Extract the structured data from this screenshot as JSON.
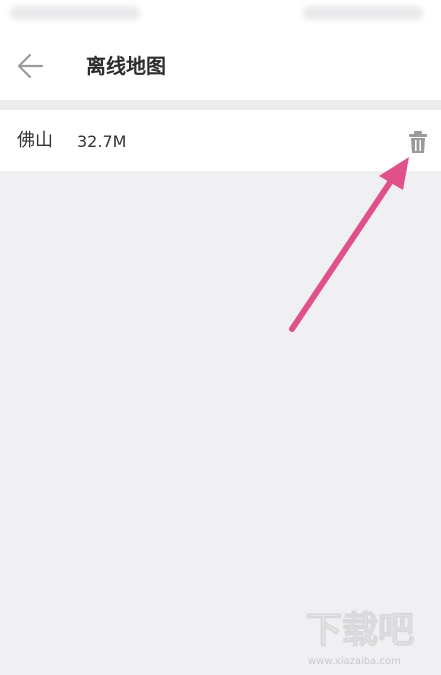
{
  "header": {
    "title": "离线地图"
  },
  "offline_maps": [
    {
      "city": "佛山",
      "size": "32.7M"
    }
  ],
  "icons": {
    "back": "arrow-left-icon",
    "delete": "trash-icon"
  },
  "colors": {
    "background": "#f0eff1",
    "annotation_arrow": "#e0508a",
    "icon_gray": "#9a9a9a"
  },
  "watermark": {
    "text": "下载吧",
    "url_text": "www.xiazaiba.com"
  }
}
